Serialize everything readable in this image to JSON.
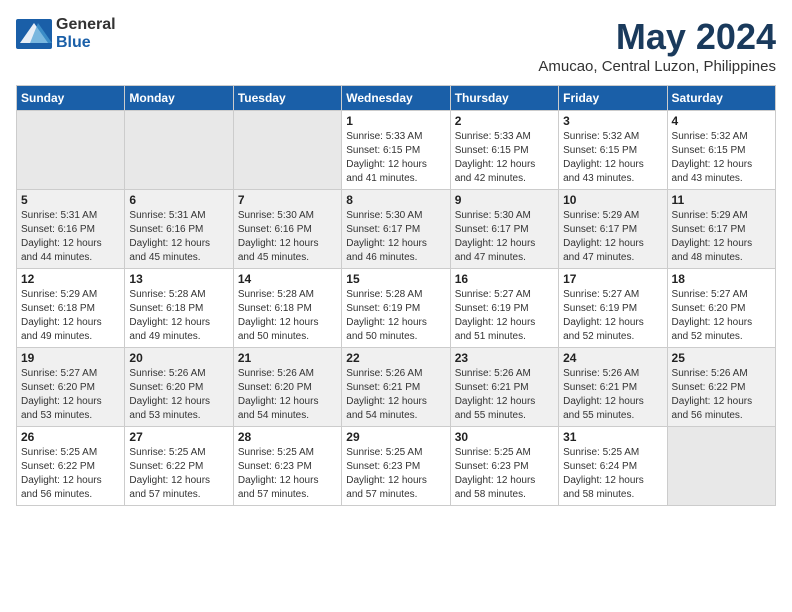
{
  "header": {
    "logo": {
      "general": "General",
      "blue": "Blue"
    },
    "month_year": "May 2024",
    "location": "Amucao, Central Luzon, Philippines"
  },
  "days_of_week": [
    "Sunday",
    "Monday",
    "Tuesday",
    "Wednesday",
    "Thursday",
    "Friday",
    "Saturday"
  ],
  "weeks": [
    [
      {
        "day": "",
        "info": ""
      },
      {
        "day": "",
        "info": ""
      },
      {
        "day": "",
        "info": ""
      },
      {
        "day": "1",
        "info": "Sunrise: 5:33 AM\nSunset: 6:15 PM\nDaylight: 12 hours\nand 41 minutes."
      },
      {
        "day": "2",
        "info": "Sunrise: 5:33 AM\nSunset: 6:15 PM\nDaylight: 12 hours\nand 42 minutes."
      },
      {
        "day": "3",
        "info": "Sunrise: 5:32 AM\nSunset: 6:15 PM\nDaylight: 12 hours\nand 43 minutes."
      },
      {
        "day": "4",
        "info": "Sunrise: 5:32 AM\nSunset: 6:15 PM\nDaylight: 12 hours\nand 43 minutes."
      }
    ],
    [
      {
        "day": "5",
        "info": "Sunrise: 5:31 AM\nSunset: 6:16 PM\nDaylight: 12 hours\nand 44 minutes."
      },
      {
        "day": "6",
        "info": "Sunrise: 5:31 AM\nSunset: 6:16 PM\nDaylight: 12 hours\nand 45 minutes."
      },
      {
        "day": "7",
        "info": "Sunrise: 5:30 AM\nSunset: 6:16 PM\nDaylight: 12 hours\nand 45 minutes."
      },
      {
        "day": "8",
        "info": "Sunrise: 5:30 AM\nSunset: 6:17 PM\nDaylight: 12 hours\nand 46 minutes."
      },
      {
        "day": "9",
        "info": "Sunrise: 5:30 AM\nSunset: 6:17 PM\nDaylight: 12 hours\nand 47 minutes."
      },
      {
        "day": "10",
        "info": "Sunrise: 5:29 AM\nSunset: 6:17 PM\nDaylight: 12 hours\nand 47 minutes."
      },
      {
        "day": "11",
        "info": "Sunrise: 5:29 AM\nSunset: 6:17 PM\nDaylight: 12 hours\nand 48 minutes."
      }
    ],
    [
      {
        "day": "12",
        "info": "Sunrise: 5:29 AM\nSunset: 6:18 PM\nDaylight: 12 hours\nand 49 minutes."
      },
      {
        "day": "13",
        "info": "Sunrise: 5:28 AM\nSunset: 6:18 PM\nDaylight: 12 hours\nand 49 minutes."
      },
      {
        "day": "14",
        "info": "Sunrise: 5:28 AM\nSunset: 6:18 PM\nDaylight: 12 hours\nand 50 minutes."
      },
      {
        "day": "15",
        "info": "Sunrise: 5:28 AM\nSunset: 6:19 PM\nDaylight: 12 hours\nand 50 minutes."
      },
      {
        "day": "16",
        "info": "Sunrise: 5:27 AM\nSunset: 6:19 PM\nDaylight: 12 hours\nand 51 minutes."
      },
      {
        "day": "17",
        "info": "Sunrise: 5:27 AM\nSunset: 6:19 PM\nDaylight: 12 hours\nand 52 minutes."
      },
      {
        "day": "18",
        "info": "Sunrise: 5:27 AM\nSunset: 6:20 PM\nDaylight: 12 hours\nand 52 minutes."
      }
    ],
    [
      {
        "day": "19",
        "info": "Sunrise: 5:27 AM\nSunset: 6:20 PM\nDaylight: 12 hours\nand 53 minutes."
      },
      {
        "day": "20",
        "info": "Sunrise: 5:26 AM\nSunset: 6:20 PM\nDaylight: 12 hours\nand 53 minutes."
      },
      {
        "day": "21",
        "info": "Sunrise: 5:26 AM\nSunset: 6:20 PM\nDaylight: 12 hours\nand 54 minutes."
      },
      {
        "day": "22",
        "info": "Sunrise: 5:26 AM\nSunset: 6:21 PM\nDaylight: 12 hours\nand 54 minutes."
      },
      {
        "day": "23",
        "info": "Sunrise: 5:26 AM\nSunset: 6:21 PM\nDaylight: 12 hours\nand 55 minutes."
      },
      {
        "day": "24",
        "info": "Sunrise: 5:26 AM\nSunset: 6:21 PM\nDaylight: 12 hours\nand 55 minutes."
      },
      {
        "day": "25",
        "info": "Sunrise: 5:26 AM\nSunset: 6:22 PM\nDaylight: 12 hours\nand 56 minutes."
      }
    ],
    [
      {
        "day": "26",
        "info": "Sunrise: 5:25 AM\nSunset: 6:22 PM\nDaylight: 12 hours\nand 56 minutes."
      },
      {
        "day": "27",
        "info": "Sunrise: 5:25 AM\nSunset: 6:22 PM\nDaylight: 12 hours\nand 57 minutes."
      },
      {
        "day": "28",
        "info": "Sunrise: 5:25 AM\nSunset: 6:23 PM\nDaylight: 12 hours\nand 57 minutes."
      },
      {
        "day": "29",
        "info": "Sunrise: 5:25 AM\nSunset: 6:23 PM\nDaylight: 12 hours\nand 57 minutes."
      },
      {
        "day": "30",
        "info": "Sunrise: 5:25 AM\nSunset: 6:23 PM\nDaylight: 12 hours\nand 58 minutes."
      },
      {
        "day": "31",
        "info": "Sunrise: 5:25 AM\nSunset: 6:24 PM\nDaylight: 12 hours\nand 58 minutes."
      },
      {
        "day": "",
        "info": ""
      }
    ]
  ]
}
